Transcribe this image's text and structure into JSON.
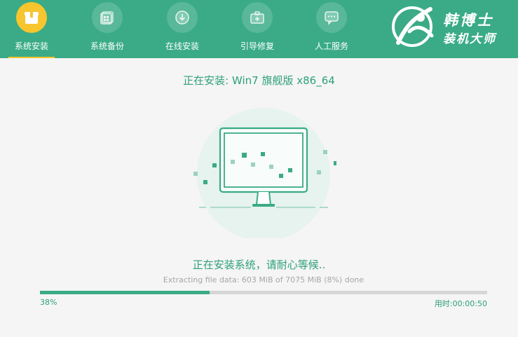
{
  "nav": {
    "items": [
      {
        "label": "系统安装",
        "icon": "install-box-icon",
        "active": true
      },
      {
        "label": "系统备份",
        "icon": "backup-windows-icon",
        "active": false
      },
      {
        "label": "在线安装",
        "icon": "online-download-icon",
        "active": false
      },
      {
        "label": "引导修复",
        "icon": "repair-toolbox-icon",
        "active": false
      },
      {
        "label": "人工服务",
        "icon": "chat-service-icon",
        "active": false
      }
    ]
  },
  "brand": {
    "line1": "韩博士",
    "line2": "装机大师"
  },
  "install": {
    "title": "正在安装: Win7 旗舰版 x86_64",
    "status": "正在安装系统，请耐心等候..",
    "detail": "Extracting file data: 603 MiB of 7075 MiB (8%) done",
    "progress_percent": 38,
    "progress_label": "38%",
    "elapsed": "用时:00:00:50"
  },
  "colors": {
    "accent": "#3aab86",
    "active_tab": "#f7c52e",
    "text_green": "#2ea07a",
    "detail_gray": "#a6a6a6",
    "background": "#f5f5f5"
  }
}
